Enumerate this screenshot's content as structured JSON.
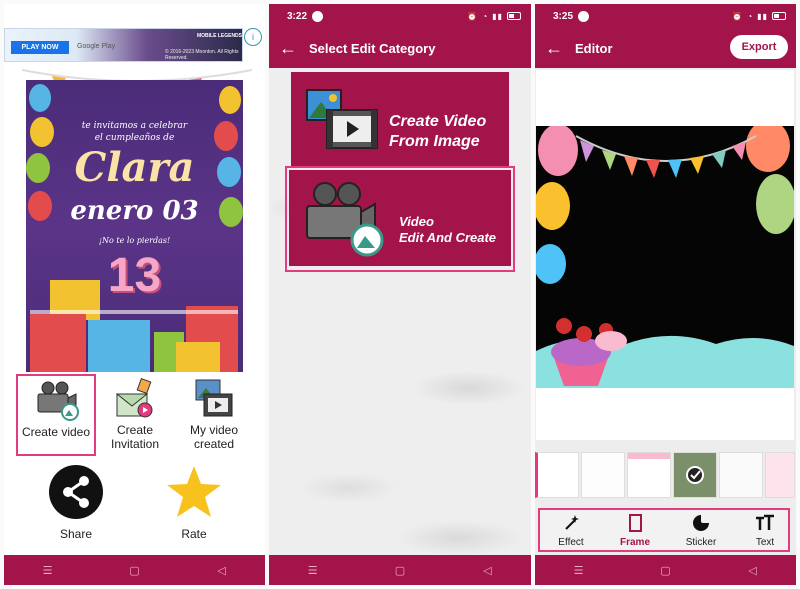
{
  "colors": {
    "primary": "#a3154a",
    "accent_outline": "#e23b80"
  },
  "screen1": {
    "ad": {
      "play_label": "PLAY NOW",
      "store_label": "Google Play",
      "brand_label": "MOBILE LEGENDS",
      "copyright": "© 2016-2023 Moonton. All Rights Reserved."
    },
    "card": {
      "invite_line1": "te invitamos a celebrar",
      "invite_line2": "el cumpleaños de",
      "name": "Clara",
      "date": "enero 03",
      "tagline": "¡No te lo pierdas!",
      "age": "13"
    },
    "menu": [
      {
        "label": "Create video",
        "icon": "camera-icon",
        "selected": true
      },
      {
        "label_line1": "Create",
        "label_line2": "Invitation",
        "icon": "invitation-icon"
      },
      {
        "label_line1": "My video",
        "label_line2": "created",
        "icon": "film-gallery-icon"
      }
    ],
    "share_label": "Share",
    "rate_label": "Rate"
  },
  "screen2": {
    "status_time": "3:22",
    "title": "Select Edit Category",
    "categories": [
      {
        "line1": "Create Video",
        "line2": "From Image",
        "icon": "image-to-video-icon"
      },
      {
        "line1": "Video",
        "line2": "Edit And Create",
        "icon": "camera-icon",
        "selected": true
      }
    ]
  },
  "screen3": {
    "status_time": "3:25",
    "title": "Editor",
    "export_label": "Export",
    "tools": [
      {
        "label": "Effect",
        "icon": "magic-wand-icon"
      },
      {
        "label": "Frame",
        "icon": "frame-icon",
        "active": true
      },
      {
        "label": "Sticker",
        "icon": "sticker-icon"
      },
      {
        "label": "Text",
        "icon": "text-icon"
      }
    ]
  }
}
